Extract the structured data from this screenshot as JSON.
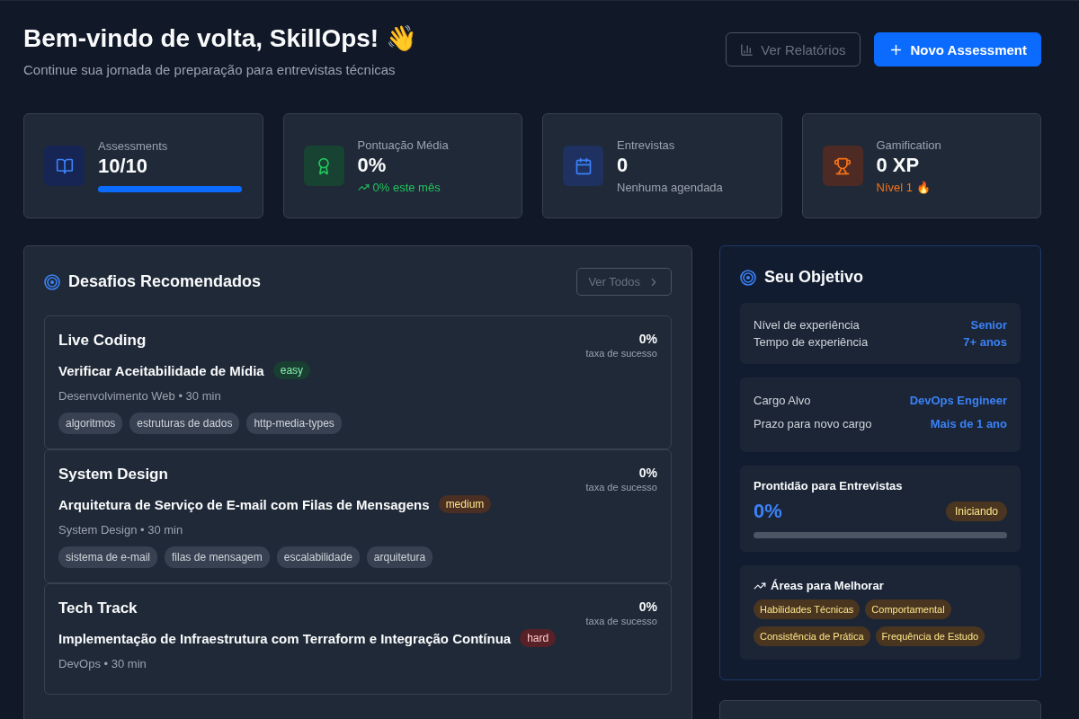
{
  "header": {
    "title": "Bem-vindo de volta, SkillOps! 👋",
    "subtitle": "Continue sua jornada de preparação para entrevistas técnicas",
    "buttons": [
      {
        "label": "Ver Relatórios",
        "kind": "outline"
      },
      {
        "label": "Novo Assessment",
        "kind": "primary"
      }
    ]
  },
  "stats": [
    {
      "kind": "progress",
      "label": "Assessments",
      "value": "10/10",
      "level": 1
    },
    {
      "kind": "trend",
      "label": "Pontuação Média",
      "value": "0%",
      "note": "0% este mês"
    },
    {
      "kind": "note",
      "label": "Entrevistas",
      "value": "0",
      "note": "Nenhuma agendada"
    },
    {
      "kind": "accent",
      "label": "Gamification",
      "value": "0 XP",
      "note": "Nível 1 🔥"
    }
  ],
  "challenges_panel": {
    "title": "Desafios Recomendados",
    "view_all": "Ver Todos",
    "items": [
      {
        "track": "Live Coding",
        "rate": "0%",
        "rate_label": "taxa de sucesso",
        "title": "Verificar Aceitabilidade de Mídia",
        "difficulty": {
          "label": "easy",
          "kind": "easy"
        },
        "meta": "Desenvolvimento Web • 30 min",
        "tags": [
          "algoritmos",
          "estruturas de dados",
          "http-media-types"
        ]
      },
      {
        "track": "System Design",
        "rate": "0%",
        "rate_label": "taxa de sucesso",
        "title": "Arquitetura de Serviço de E-mail com Filas de Mensagens",
        "difficulty": {
          "label": "medium",
          "kind": "medium"
        },
        "meta": "System Design • 30 min",
        "tags": [
          "sistema de e-mail",
          "filas de mensagem",
          "escalabilidade",
          "arquitetura"
        ]
      },
      {
        "track": "Tech Track",
        "rate": "0%",
        "rate_label": "taxa de sucesso",
        "title": "Implementação de Infraestrutura com Terraform e Integração Contínua",
        "difficulty": {
          "label": "hard",
          "kind": "hard"
        },
        "meta": "DevOps • 30 min"
      }
    ]
  },
  "goal_panel": {
    "title": "Seu Objetivo",
    "groups": [
      [
        {
          "label": "Nível de experiência",
          "value": "Senior"
        },
        {
          "label": "Tempo de experiência",
          "value": "7+ anos"
        }
      ],
      [
        {
          "label": "Cargo Alvo",
          "value": "DevOps Engineer"
        },
        {
          "label": "Prazo para novo cargo",
          "value": "Mais de 1 ano"
        }
      ]
    ],
    "readiness": {
      "title": "Prontidão para Entrevistas",
      "value": "0%",
      "status": "Iniciando",
      "level": 0
    },
    "improve": {
      "title": "Áreas para Melhorar",
      "tags": [
        "Habilidades Técnicas",
        "Comportamental",
        "Consistência de Prática",
        "Frequência de Estudo"
      ]
    }
  }
}
